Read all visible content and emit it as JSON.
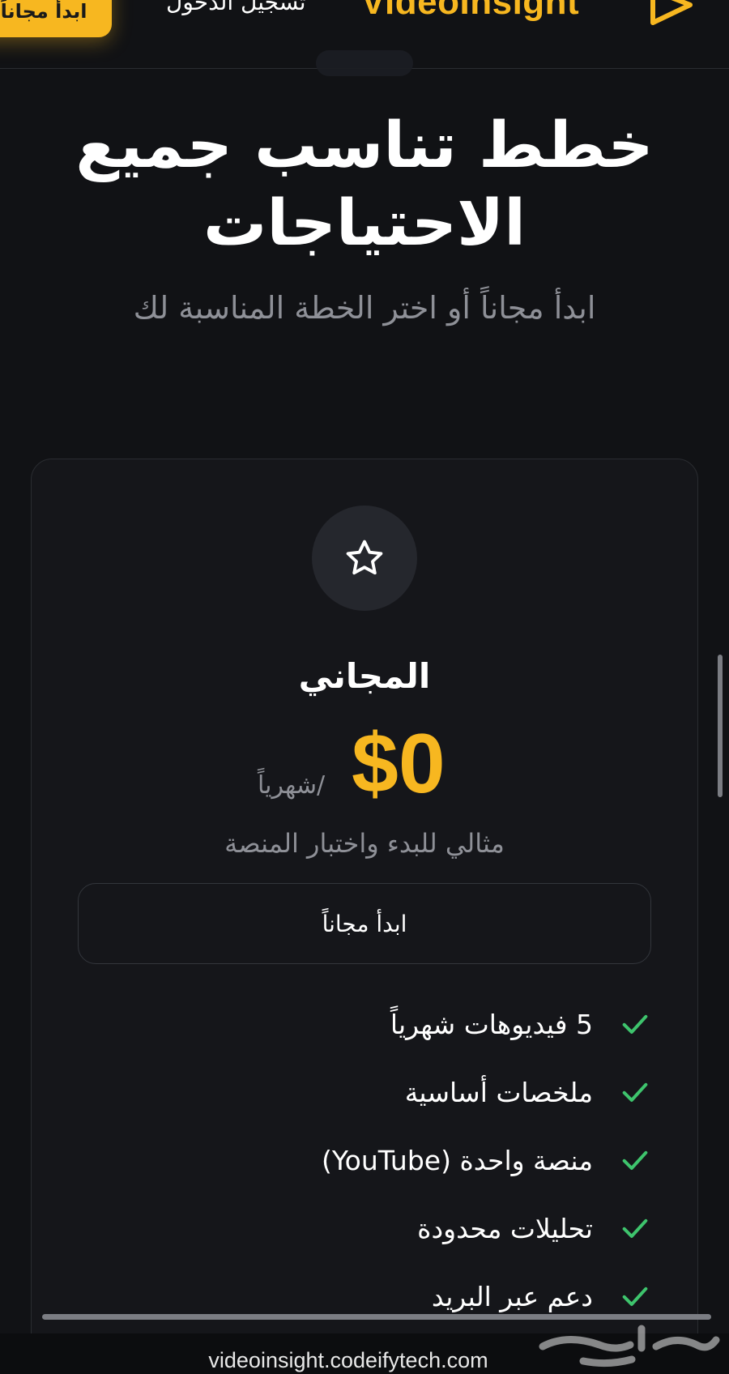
{
  "header": {
    "cta_label": "ابدأ مجاناً",
    "login_label": "تسجيل الدخول",
    "brand_name": "VideoInsight",
    "brand_icon": "play-triangle-icon"
  },
  "hero": {
    "title_line1": "خطط تناسب جميع",
    "title_line2": "الاحتياجات",
    "subtitle": "ابدأ مجاناً أو اختر الخطة المناسبة لك"
  },
  "plan": {
    "icon": "star-icon",
    "name": "المجاني",
    "price": "$0",
    "period": "/شهرياً",
    "description": "مثالي للبدء واختبار المنصة",
    "button_label": "ابدأ مجاناً",
    "features": [
      "5 فيديوهات شهرياً",
      "ملخصات أساسية",
      "منصة واحدة (YouTube)",
      "تحليلات محدودة",
      "دعم عبر البريد"
    ]
  },
  "browser": {
    "url": "videoinsight.codeifytech.com"
  },
  "colors": {
    "background": "#111215",
    "accent": "#f7b720",
    "muted_text": "#8e9097",
    "check_green": "#3ec46d",
    "card_border": "#2a2c31"
  }
}
